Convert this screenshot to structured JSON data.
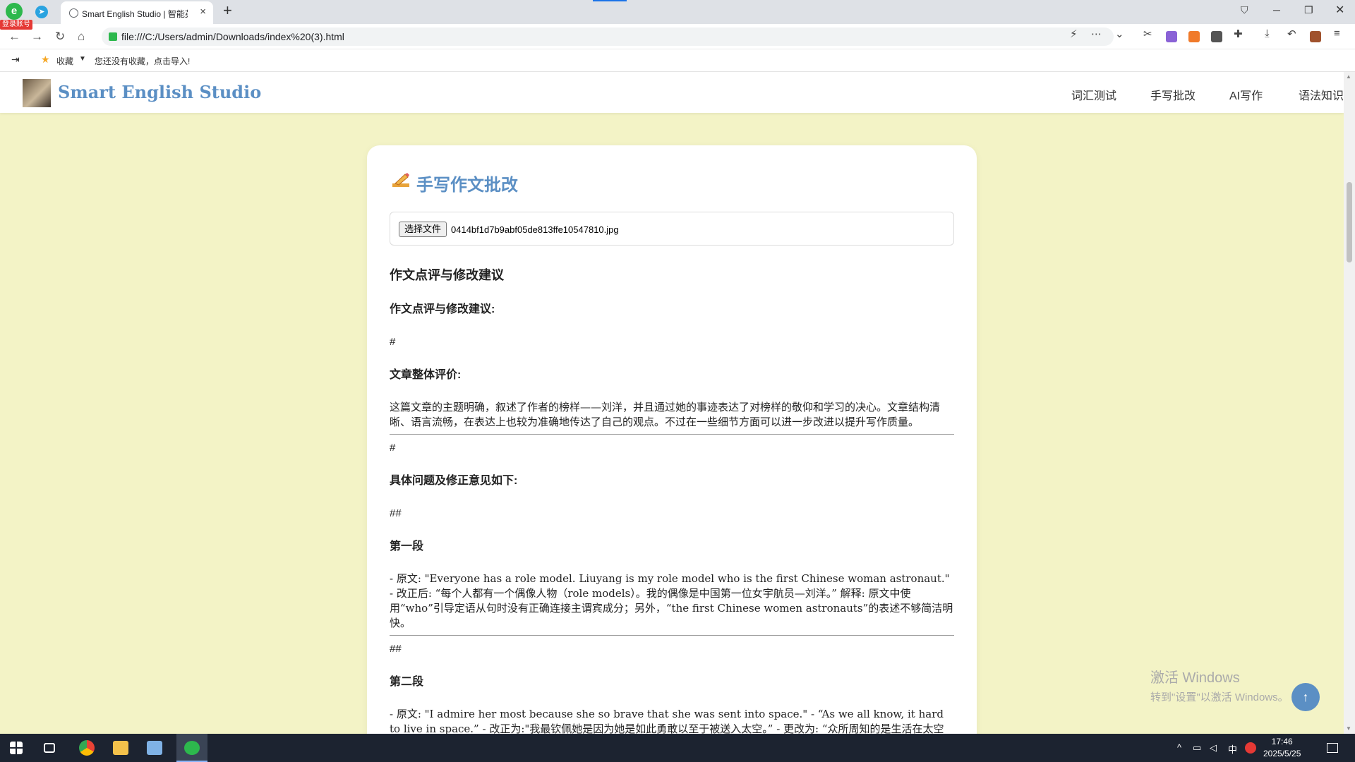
{
  "browser": {
    "login_badge": "登录账号",
    "tab_title": "Smart English Studio | 智能英语",
    "tab_close": "×",
    "new_tab": "+",
    "url": "file:///C:/Users/admin/Downloads/index%20(3).html",
    "bookmarks_label": "收藏",
    "bookmarks_hint": "您还没有收藏，点击导入!"
  },
  "site": {
    "title": "Smart English Studio",
    "nav": [
      "词汇测试",
      "手写批改",
      "AI写作",
      "语法知识"
    ]
  },
  "card": {
    "title": "手写作文批改",
    "file_button": "选择文件",
    "file_name": "0414bf1d7b9abf05de813ffe10547810.jpg"
  },
  "result": {
    "heading": "作文点评与修改建议",
    "subheading": "作文点评与修改建议:",
    "hash1": "#",
    "overall_label": "文章整体评价:",
    "overall_text": "这篇文章的主题明确，叙述了作者的榜样——刘洋，并且通过她的事迹表达了对榜样的敬仰和学习的决心。文章结构清晰、语言流畅，在表达上也较为准确地传达了自己的观点。不过在一些细节方面可以进一步改进以提升写作质量。",
    "hash2": "#",
    "issues_label": "具体问题及修正意见如下:",
    "hash3": "##",
    "para1_label": "第一段",
    "para1_text": "- 原文: \"Everyone has a role model. Liuyang is my role model who is the first Chinese woman astronaut.\" - 改正后: “每个人都有一个偶像人物（role models）。我的偶像是中国第一位女宇航员—刘洋。” 解释: 原文中使用“who”引导定语从句时没有正确连接主谓宾成分；另外，“the first Chinese women astronauts”的表述不够简洁明快。",
    "hash4": "##",
    "para2_label": "第二段",
    "para2_text": "- 原文: \"I admire her most because she so brave that she was sent into space.\" - “As we all know, it hard to live in space.” - 改正为:\"我最钦佩她是因为她是如此勇敢以至于被送入太空。” - 更改为: “众所周知的是生活在太空中非常困难。” 说明: 第一句话中的\"so...that...\"结构不完整需要补充连词才能构成完整的句子;第二句话语"
  },
  "watermark": {
    "line1": "激活 Windows",
    "line2": "转到\"设置\"以激活 Windows。"
  },
  "taskbar": {
    "ime": "中",
    "time": "17:46",
    "date": "2025/5/25"
  }
}
